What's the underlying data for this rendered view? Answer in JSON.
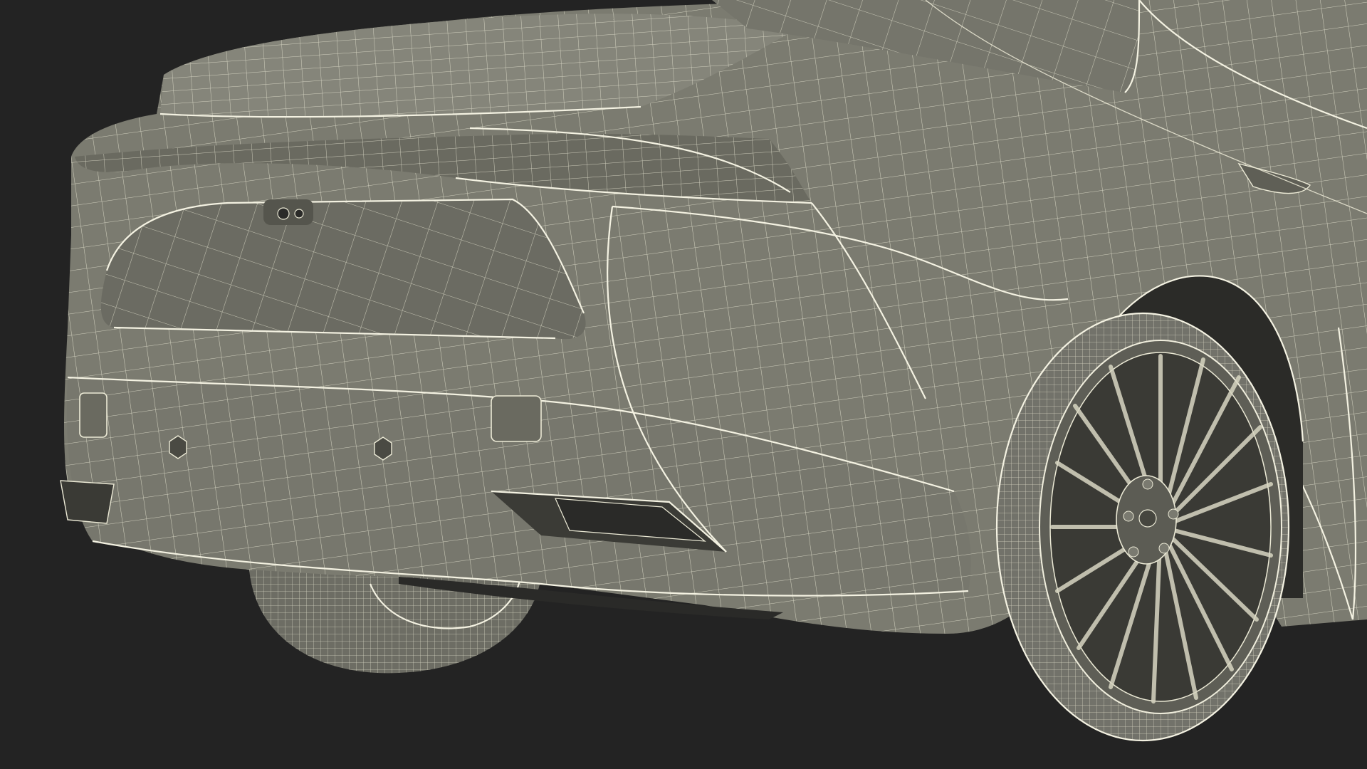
{
  "scene": {
    "subject": "wireframe-render",
    "colors": {
      "background": "#232323",
      "body_fill": "#7b7b70",
      "body_shadow": "#5f5f56",
      "wire": "#ecead6",
      "tire_fill": "#6f6f66",
      "dark_detail": "#2a2a28"
    }
  }
}
